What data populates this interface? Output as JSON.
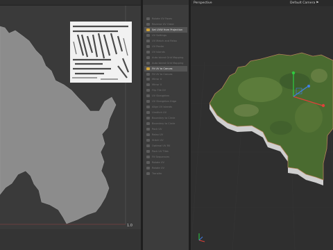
{
  "uv_editor": {
    "corner_label": "1.0"
  },
  "tools": {
    "items": [
      {
        "label": "Rotate UV Faces",
        "state": "dim"
      },
      {
        "label": "Reverse UV Order",
        "state": "dim"
      },
      {
        "label": "Set UVW from Projection",
        "state": "hl"
      },
      {
        "label": "UV Settings",
        "state": "dim"
      },
      {
        "label": "UV Match and Relax",
        "state": "dim"
      },
      {
        "label": "UV Peeler",
        "state": "dim"
      },
      {
        "label": "UV Islands",
        "state": "dim"
      },
      {
        "label": "Auto Island Grid Mapping",
        "state": "dim"
      },
      {
        "label": "Auto Island Grid Mapping",
        "state": "dim"
      },
      {
        "label": "Fit UV to Canvas",
        "state": "hl"
      },
      {
        "label": "Fit UV to Canvas",
        "state": "dim"
      },
      {
        "label": "Mirror U",
        "state": "dim"
      },
      {
        "label": "Mirror V",
        "state": "dim"
      },
      {
        "label": "Flip Tile UV",
        "state": "dim"
      },
      {
        "label": "UV Straighten",
        "state": "dim"
      },
      {
        "label": "UV Straighten Edge",
        "state": "dim"
      },
      {
        "label": "Align UV Islands",
        "state": "dim"
      },
      {
        "label": "Unstitch UV",
        "state": "dim"
      },
      {
        "label": "Boundary to Circle",
        "state": "dim"
      },
      {
        "label": "Boundary to Circle",
        "state": "dim"
      },
      {
        "label": "Pack UV",
        "state": "dim"
      },
      {
        "label": "Relax UV",
        "state": "dim"
      },
      {
        "label": "Stitch UV",
        "state": "dim"
      },
      {
        "label": "Optimal UV Fill",
        "state": "dim"
      },
      {
        "label": "Pack UV Tiles",
        "state": "dim"
      },
      {
        "label": "Fit Sequences",
        "state": "dim"
      },
      {
        "label": "Rotate UV",
        "state": "dim"
      },
      {
        "label": "Rotate UV",
        "state": "dim"
      },
      {
        "label": "Transfer",
        "state": "dim"
      }
    ]
  },
  "viewport": {
    "title": "Perspective",
    "camera": "Default Camera",
    "camera_icon": "flag-icon"
  },
  "colors": {
    "uv_background": "#3a3a3a",
    "uv_map_fill": "#8c8c8c",
    "tools_background": "#3c3c3c",
    "highlight": "#545454",
    "viewport_background": "#2f2f2f",
    "terrain": "#4a6b30",
    "gizmo_y": "#2ecc40",
    "gizmo_x": "#e0403a",
    "gizmo_z": "#3f7fe8"
  }
}
